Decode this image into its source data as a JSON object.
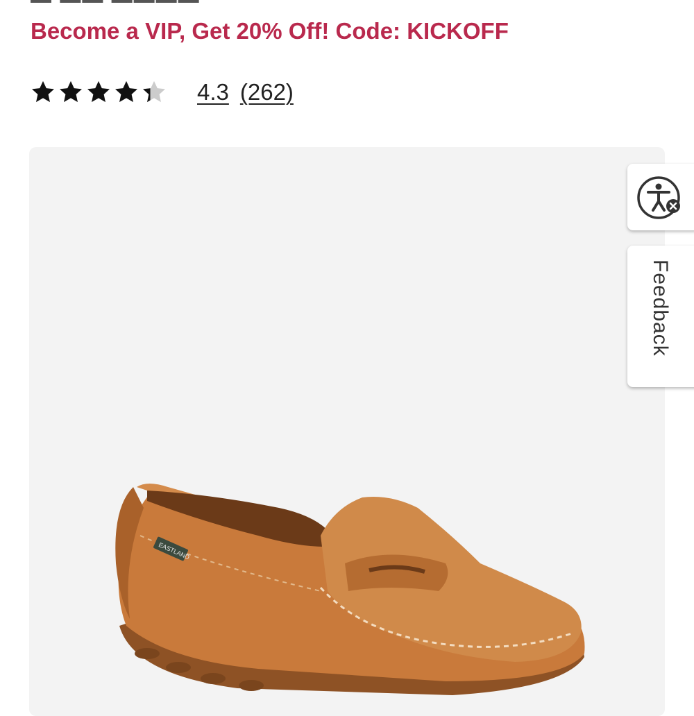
{
  "promo": {
    "text": "Become a VIP, Get 20% Off! Code: KICKOFF",
    "color": "#b9294d"
  },
  "rating": {
    "value": "4.3",
    "count_label": "(262)",
    "stars_filled_fraction": 0.86,
    "star_color": "#111111",
    "star_empty_color": "#cccccc"
  },
  "product_image": {
    "icon": "loafer-shoe-image",
    "shoe_color": "#c97a3b",
    "background": "#f3f3f3"
  },
  "side_tabs": {
    "accessibility_icon": "accessibility-icon",
    "feedback_label": "Feedback"
  }
}
